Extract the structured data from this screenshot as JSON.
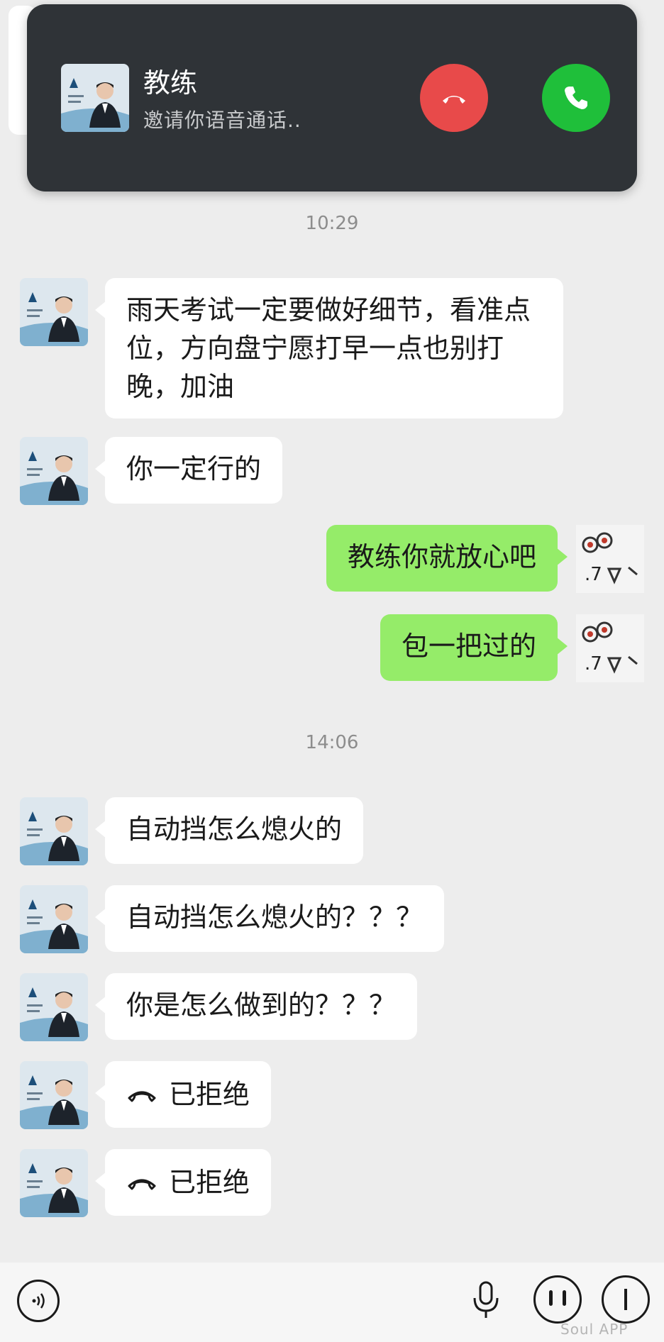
{
  "incoming_call": {
    "caller_name": "教练",
    "subtitle": "邀请你语音通话..",
    "decline_icon": "hang-up-icon",
    "accept_icon": "phone-icon",
    "decline_color": "#e84a4a",
    "accept_color": "#1fbf3a"
  },
  "timestamps": [
    "10:29",
    "14:06"
  ],
  "messages": [
    {
      "side": "in",
      "text": "雨天考试一定要做好细节，看准点位，方向盘宁愿打早一点也别打晚，加油"
    },
    {
      "side": "in",
      "text": "你一定行的"
    },
    {
      "side": "out",
      "text": "教练你就放心吧"
    },
    {
      "side": "out",
      "text": "包一把过的"
    },
    {
      "side": "in",
      "text": "自动挡怎么熄火的"
    },
    {
      "side": "in",
      "text": "自动挡怎么熄火的？？？"
    },
    {
      "side": "in",
      "text": "你是怎么做到的？？？"
    },
    {
      "side": "in",
      "type": "call-record",
      "icon": "declined-call-icon",
      "text": "已拒绝"
    },
    {
      "side": "in",
      "type": "call-record",
      "icon": "declined-call-icon",
      "text": "已拒绝"
    }
  ],
  "colors": {
    "background": "#ededed",
    "incoming_bubble": "#ffffff",
    "outgoing_bubble": "#95ec69",
    "call_banner": "#2f3337"
  },
  "watermark": "Soul APP"
}
